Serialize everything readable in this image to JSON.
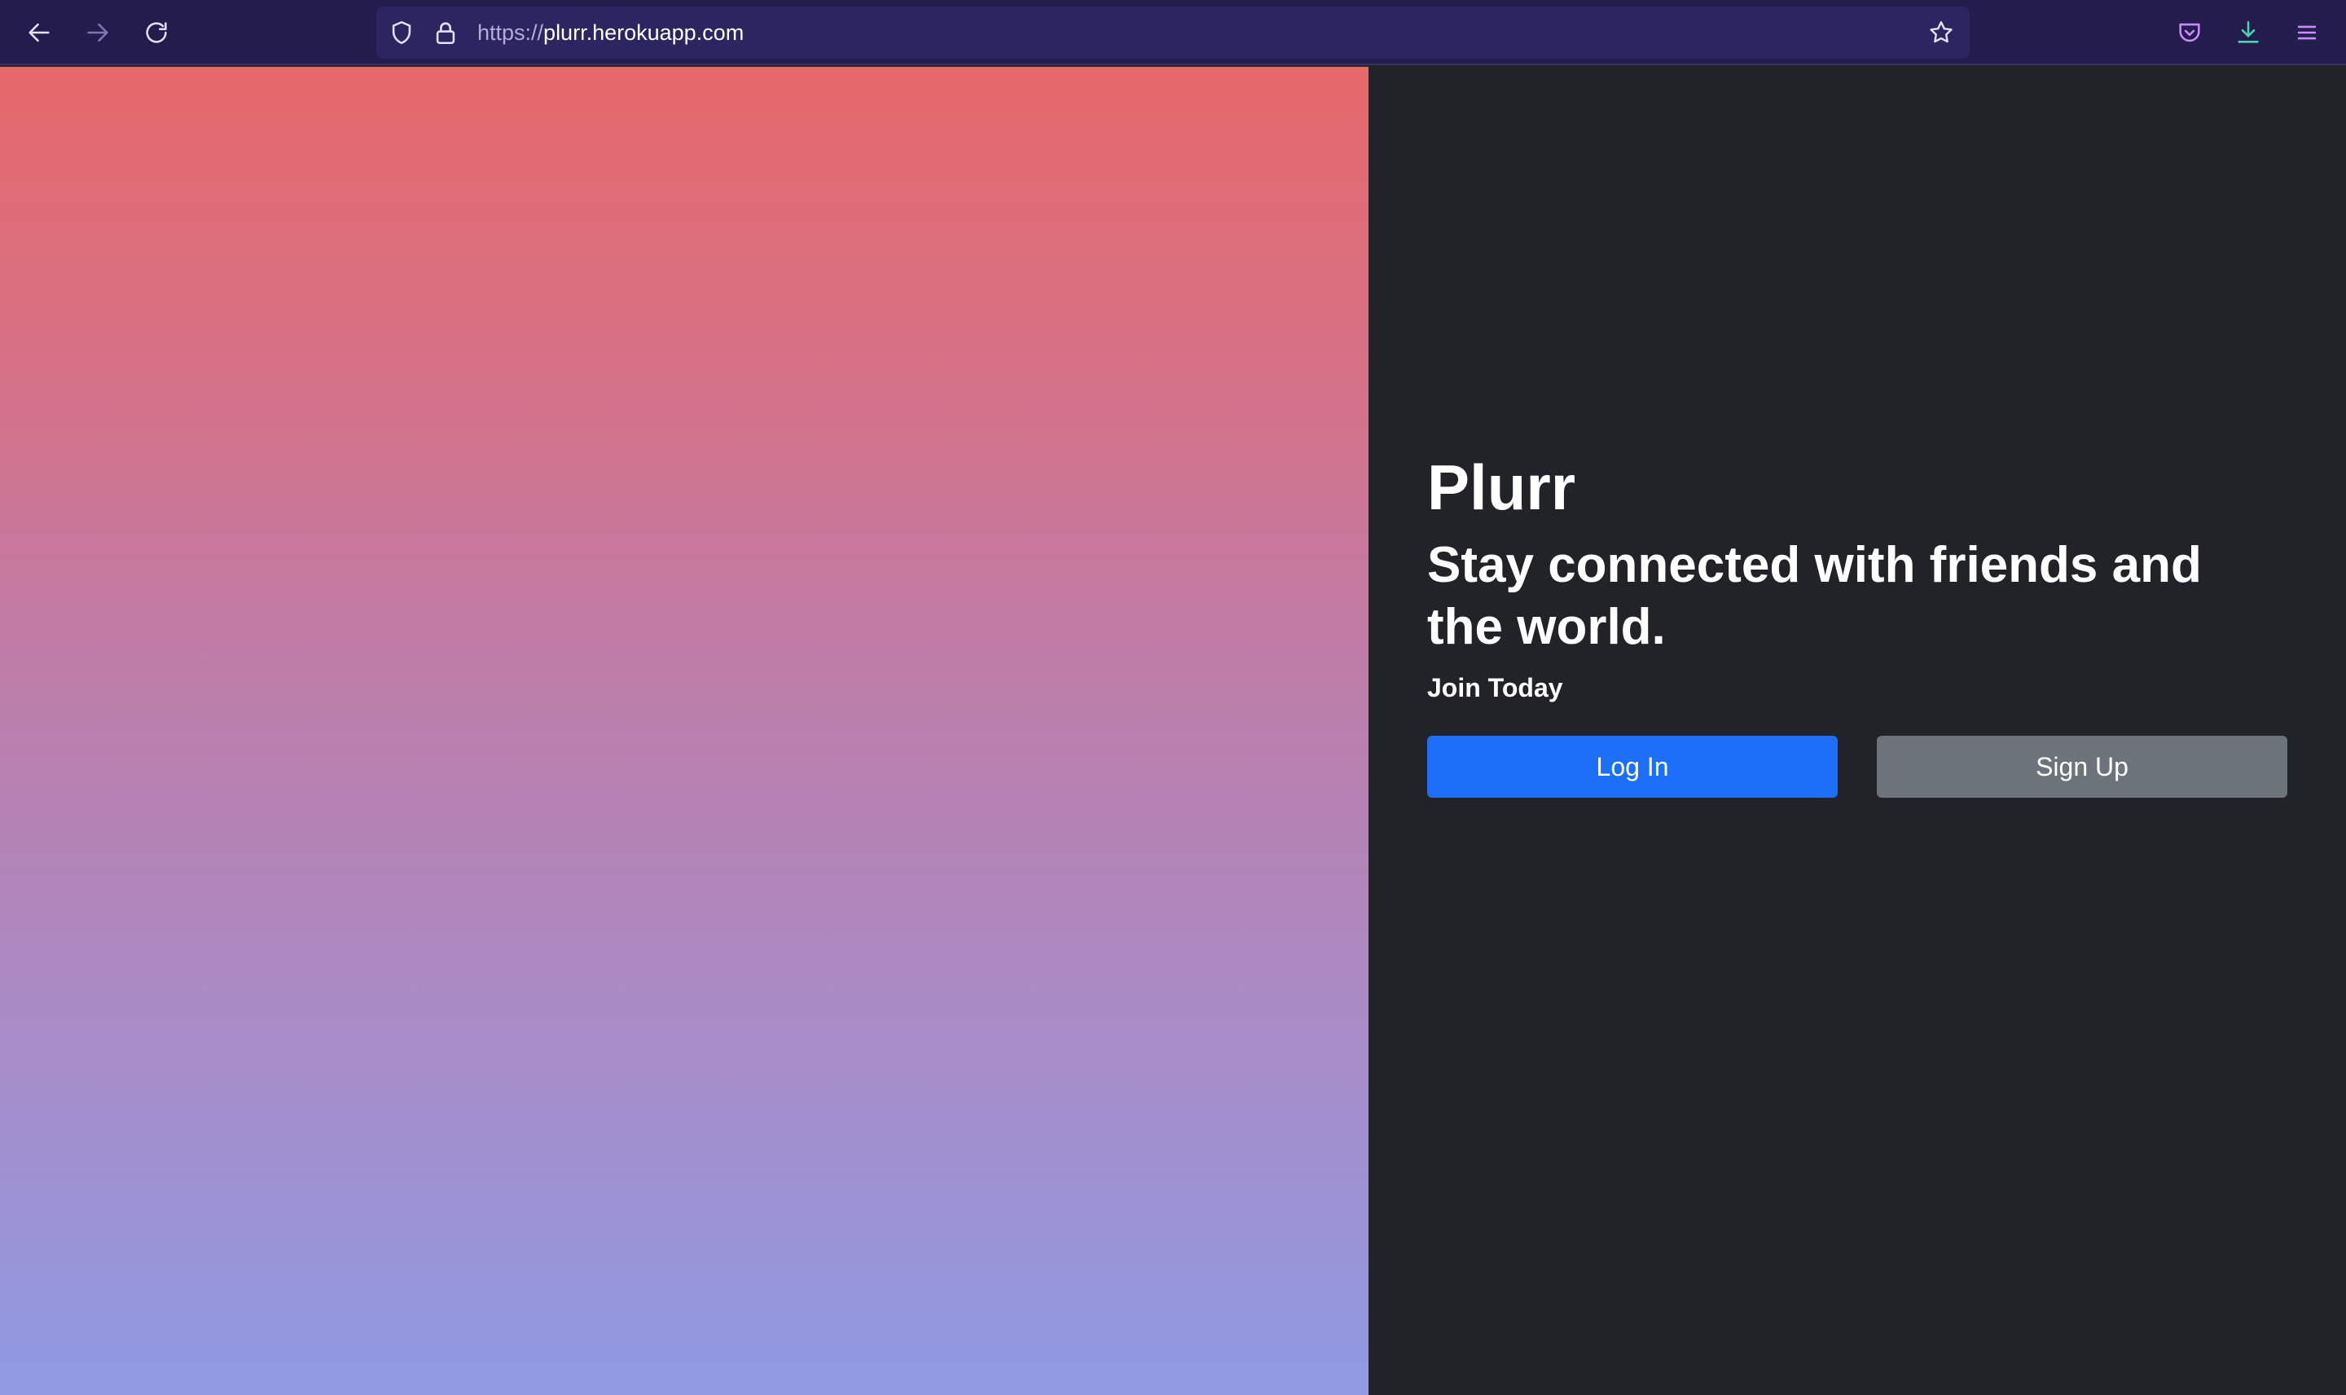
{
  "browser": {
    "url_scheme": "https://",
    "url_host": "plurr.herokuapp.com",
    "icons": {
      "back": "back-arrow-icon",
      "forward": "forward-arrow-icon",
      "reload": "reload-icon",
      "tracking_protection": "shield-icon",
      "secure": "lock-icon",
      "bookmark": "star-icon",
      "pocket": "pocket-icon",
      "downloads": "download-icon",
      "menu": "hamburger-menu-icon"
    },
    "colors": {
      "toolbar": "#231c4d",
      "urlbar": "#2d2560",
      "icon": "#e6e0ff",
      "accent_download": "#44d6b5",
      "accent_pocket": "#c98cff"
    }
  },
  "page": {
    "title": "Plurr",
    "tagline": "Stay connected with friends and the world.",
    "join_text": "Join Today",
    "login_label": "Log In",
    "signup_label": "Sign Up",
    "colors": {
      "panel_bg": "#212329",
      "login_button": "#1d6ffa",
      "signup_button": "#6c737b",
      "gradient_top": "#e6686a",
      "gradient_bottom": "#8f9ae3"
    }
  }
}
